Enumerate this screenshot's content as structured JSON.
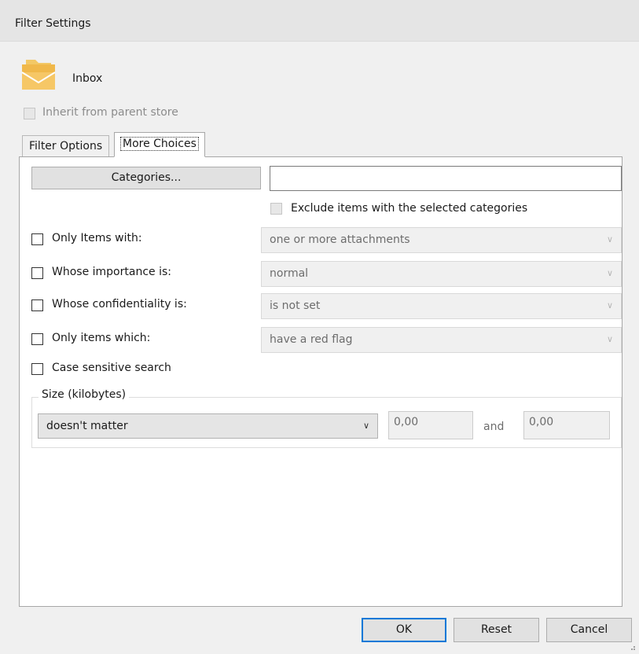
{
  "window": {
    "title": "Filter Settings"
  },
  "folder": {
    "icon": "folder-mail-icon",
    "name": "Inbox",
    "color": "#f0b84a"
  },
  "inherit": {
    "label": "Inherit from parent store",
    "checked": false,
    "enabled": false
  },
  "tabs": [
    {
      "label": "Filter Options",
      "active": false
    },
    {
      "label": "More Choices",
      "active": true
    }
  ],
  "categories": {
    "button_label": "Categories...",
    "value": ""
  },
  "exclude": {
    "label": "Exclude items with the selected categories",
    "checked": false,
    "enabled": false
  },
  "conditions": [
    {
      "label": "Only Items with:",
      "checked": false,
      "select_value": "one or more attachments"
    },
    {
      "label": "Whose importance is:",
      "checked": false,
      "select_value": "normal"
    },
    {
      "label": "Whose confidentiality is:",
      "checked": false,
      "select_value": "is not set"
    },
    {
      "label": "Only items which:",
      "checked": false,
      "select_value": "have a red flag"
    }
  ],
  "case_sensitive": {
    "label": "Case sensitive search",
    "checked": false
  },
  "size": {
    "group_title": "Size (kilobytes)",
    "mode": "doesn't matter",
    "min": "0,00",
    "and_label": "and",
    "max": "0,00"
  },
  "buttons": {
    "ok": "OK",
    "reset": "Reset",
    "cancel": "Cancel"
  }
}
